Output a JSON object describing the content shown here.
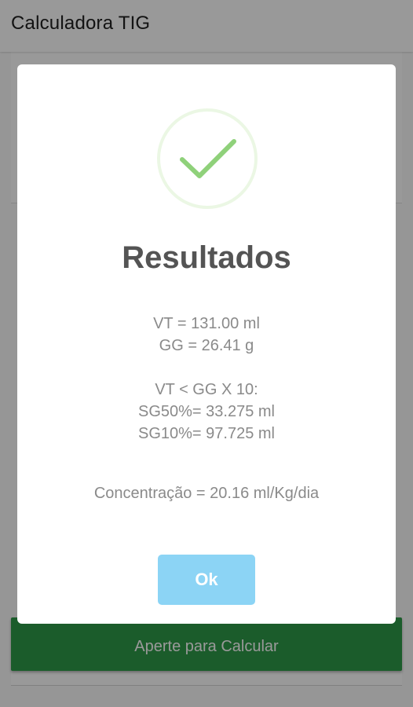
{
  "app": {
    "title": "Calculadora TIG",
    "calculate_button_label": "Aperte para Calcular"
  },
  "dialog": {
    "icon": "check-icon",
    "title": "Resultados",
    "results": {
      "vt": "VT = 131.00 ml",
      "gg": "GG = 26.41 g",
      "condition": "VT < GG X 10:",
      "sg50": "SG50%= 33.275 ml",
      "sg10": "SG10%= 97.725 ml",
      "concentration": "Concentração = 20.16 ml/Kg/dia"
    },
    "ok_label": "Ok"
  },
  "colors": {
    "primary_green": "#2e9a48",
    "success_check": "#8fd17a",
    "ok_button": "#8cd4f5",
    "title_text": "#545454",
    "result_text": "#8a8a8a"
  }
}
